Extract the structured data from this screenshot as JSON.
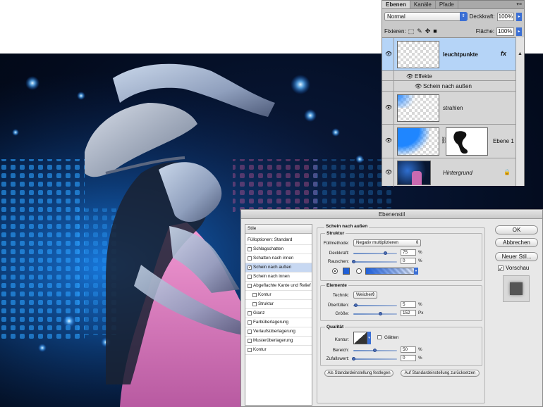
{
  "layers_panel": {
    "tabs": [
      "Ebenen",
      "Kanäle",
      "Pfade"
    ],
    "blend_mode": "Normal",
    "opacity_label": "Deckkraft:",
    "opacity_value": "100%",
    "lock_label": "Fixieren:",
    "fill_label": "Fläche:",
    "fill_value": "100%",
    "fx_badge": "fx",
    "layers": [
      {
        "name": "leuchtpunkte",
        "selected": true
      },
      {
        "name": "Effekte"
      },
      {
        "name": "Schein nach außen"
      },
      {
        "name": "strahlen"
      },
      {
        "name": "Ebene 1"
      },
      {
        "name": "Hintergrund",
        "italic": true
      }
    ]
  },
  "dialog": {
    "title": "Ebenenstil",
    "styles_header": "Stile",
    "styles": [
      {
        "label": "Fülloptionen: Standard",
        "checkbox": false
      },
      {
        "label": "Schlagschatten",
        "checked": false
      },
      {
        "label": "Schatten nach innen",
        "checked": false
      },
      {
        "label": "Schein nach außen",
        "checked": true,
        "selected": true
      },
      {
        "label": "Schein nach innen",
        "checked": false
      },
      {
        "label": "Abgeflachte Kante und Relief",
        "checked": false
      },
      {
        "label": "Kontur",
        "checked": false,
        "indent": true
      },
      {
        "label": "Struktur",
        "checked": false,
        "indent": true
      },
      {
        "label": "Glanz",
        "checked": false
      },
      {
        "label": "Farbüberlagerung",
        "checked": false
      },
      {
        "label": "Verlaufsüberlagerung",
        "checked": false
      },
      {
        "label": "Musterüberlagerung",
        "checked": false
      },
      {
        "label": "Kontur",
        "checked": false
      }
    ],
    "section_title": "Schein nach außen",
    "structure": {
      "title": "Struktur",
      "blend_label": "Füllmethode:",
      "blend_value": "Negativ multiplizieren",
      "opacity_label": "Deckkraft:",
      "opacity_value": "75",
      "noise_label": "Rauschen:",
      "noise_value": "0",
      "unit_pct": "%"
    },
    "elements": {
      "title": "Elemente",
      "technique_label": "Technik:",
      "technique_value": "Weicher",
      "spread_label": "Überfüllen:",
      "spread_value": "5",
      "size_label": "Größe:",
      "size_value": "152",
      "unit_px": "Px"
    },
    "quality": {
      "title": "Qualität",
      "contour_label": "Kontur:",
      "antialias_label": "Glätten",
      "range_label": "Bereich:",
      "range_value": "50",
      "jitter_label": "Zufallswert:",
      "jitter_value": "0"
    },
    "buttons": {
      "set_default": "Als Standardeinstellung festlegen",
      "reset_default": "Auf Standardeinstellung zurücksetzen",
      "ok": "OK",
      "cancel": "Abbrechen",
      "new_style": "Neuer Stil...",
      "preview": "Vorschau"
    },
    "glow_color": "#1f5fd8"
  }
}
